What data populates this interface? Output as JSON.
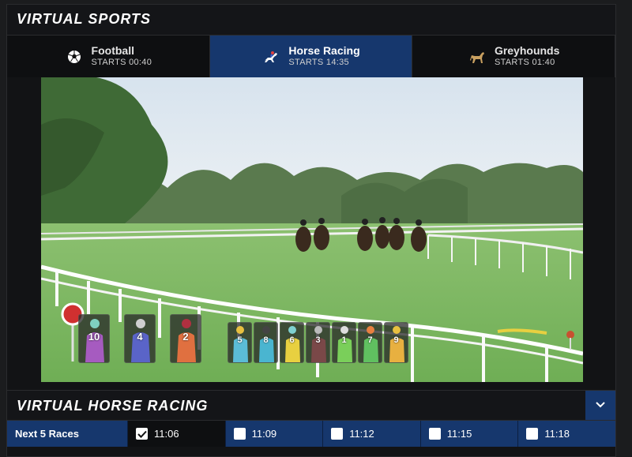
{
  "header": {
    "title": "Virtual Sports"
  },
  "tabs": [
    {
      "name": "Football",
      "starts": "STARTS 00:40",
      "icon": "football-icon",
      "active": false
    },
    {
      "name": "Horse Racing",
      "starts": "STARTS 14:35",
      "icon": "horse-icon",
      "active": true
    },
    {
      "name": "Greyhounds",
      "starts": "STARTS 01:40",
      "icon": "greyhound-icon",
      "active": false
    }
  ],
  "video": {
    "silks_left": [
      {
        "number": "10",
        "color": "#a65bc0"
      },
      {
        "number": "4",
        "color": "#5a64c8"
      },
      {
        "number": "2",
        "color": "#e07040"
      }
    ],
    "silks_right": [
      {
        "number": "5",
        "color": "#5bbcd6"
      },
      {
        "number": "8",
        "color": "#4ab5d0"
      },
      {
        "number": "6",
        "color": "#e8d040"
      },
      {
        "number": "3",
        "color": "#7a4848"
      },
      {
        "number": "1",
        "color": "#7acf5a"
      },
      {
        "number": "7",
        "color": "#60c060"
      },
      {
        "number": "9",
        "color": "#e8b040"
      }
    ]
  },
  "section": {
    "title": "Virtual Horse Racing"
  },
  "races": {
    "label": "Next 5 Races",
    "items": [
      {
        "time": "11:06",
        "selected": true
      },
      {
        "time": "11:09",
        "selected": false
      },
      {
        "time": "11:12",
        "selected": false
      },
      {
        "time": "11:15",
        "selected": false
      },
      {
        "time": "11:18",
        "selected": false
      }
    ]
  },
  "colors": {
    "accent": "#16376d",
    "background": "#121315"
  }
}
